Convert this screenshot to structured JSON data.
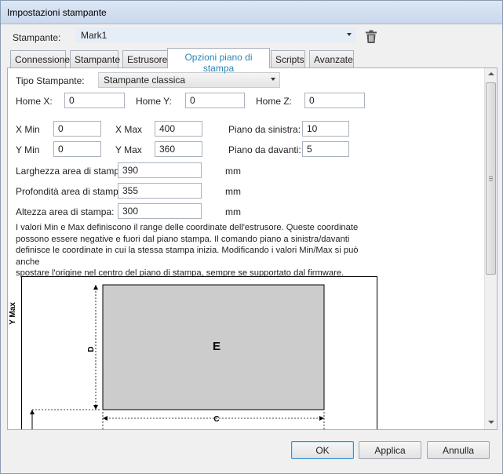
{
  "window": {
    "title": "Impostazioni stampante"
  },
  "printer": {
    "label": "Stampante:",
    "value": "Mark1"
  },
  "tabs": [
    {
      "label": "Connessione"
    },
    {
      "label": "Stampante"
    },
    {
      "label": "Estrusore"
    },
    {
      "label": "Opzioni piano di stampa"
    },
    {
      "label": "Scripts"
    },
    {
      "label": "Avanzate"
    }
  ],
  "bed": {
    "printer_type_label": "Tipo Stampante:",
    "printer_type_value": "Stampante classica",
    "home_x_label": "Home X:",
    "home_x": "0",
    "home_y_label": "Home Y:",
    "home_y": "0",
    "home_z_label": "Home Z:",
    "home_z": "0",
    "x_min_label": "X Min",
    "x_min": "0",
    "x_max_label": "X Max",
    "x_max": "400",
    "y_min_label": "Y Min",
    "y_min": "0",
    "y_max_label": "Y Max",
    "y_max": "360",
    "bed_left_label": "Piano da sinistra:",
    "bed_left": "10",
    "bed_front_label": "Piano da davanti:",
    "bed_front": "5",
    "width_label": "Larghezza area di stampa:",
    "width": "390",
    "depth_label": "Profondità area di stampa:",
    "depth": "355",
    "height_label": "Altezza area di stampa:",
    "height": "300",
    "unit": "mm",
    "info_lines": [
      "I valori Min e Max definiscono il range delle coordinate dell'estrusore. Queste coordinate",
      "possono essere negative e fuori dal piano stampa. Il comando piano a sinistra/davanti",
      "definisce le coordinate in cui la stessa stampa inizia. Modificando i valori Min/Max si può anche",
      "spostare l'origine nel centro del piano di stampa, sempre se supportato dal firmware."
    ]
  },
  "diagram": {
    "y_axis_label": "Y Max",
    "depth_marker": "D",
    "area_marker": "E",
    "width_marker": "C"
  },
  "buttons": {
    "ok": "OK",
    "apply": "Applica",
    "cancel": "Annulla"
  }
}
